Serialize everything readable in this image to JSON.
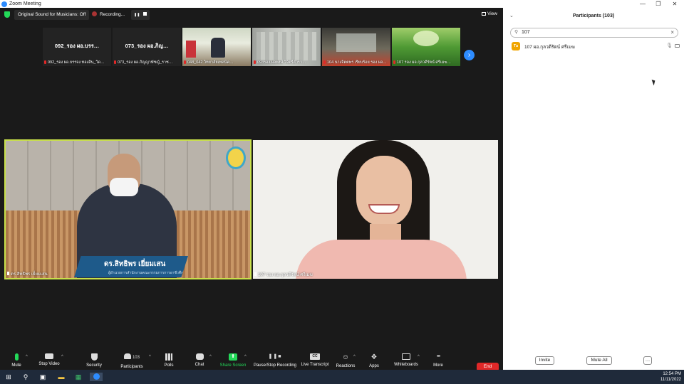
{
  "window": {
    "title": "Zoom Meeting",
    "minimize": "—",
    "restore": "❐",
    "close": "✕"
  },
  "topbar": {
    "sound_label": "Original Sound for Musicians: Off",
    "recording_label": "Recording...",
    "pause_glyph": "❚❚",
    "view_label": "View"
  },
  "thumbnails": [
    {
      "big_name": "092_รอง ผอ.บรร…",
      "caption": "092_รอง ผอ.บรรจง ทองสิน_วิด…"
    },
    {
      "big_name": "073_รอง ผอ.ภิญ…",
      "caption": "073_รอง ผอ.ภิญญาพัชญ์_ราช…"
    },
    {
      "big_name": "",
      "caption": "048_042 วิทยาลัยเทคนิค…"
    },
    {
      "big_name": "",
      "caption": "093รอง.ผอพงษ์ วิจิตรีสำรา…"
    },
    {
      "big_name": "",
      "caption": "104 นางจิตตพร เรียบร้อย รอง ผอ…"
    },
    {
      "big_name": "",
      "caption": "107 รอง ผอ.กุลวดีรัตน์ ศรีเมฆ…"
    }
  ],
  "next_arrow": "›",
  "main_left": {
    "banner_name": "ดร.สิทธิพร เยี่ยมเสน",
    "banner_sub": "ผู้อำนวยการสำนักงานคณะกรรมการการอาชีวศึกษา",
    "caption": "ดร.สิทธิพร เยี่ยมเสน"
  },
  "main_right": {
    "caption": "107 รอง ผอ.กุลวดีรัตน์ ศรีเมฆ"
  },
  "toolbar": {
    "items": [
      {
        "label": "Mute",
        "glyph": "🎙"
      },
      {
        "label": "Stop Video",
        "glyph": "📹"
      },
      {
        "label": "Security",
        "glyph": "🛡"
      },
      {
        "label": "Participants",
        "glyph": "👥",
        "count": "103"
      },
      {
        "label": "Polls",
        "glyph": "📊"
      },
      {
        "label": "Chat",
        "glyph": "💬"
      },
      {
        "label": "Share Screen",
        "glyph": "⬆"
      },
      {
        "label": "Pause/Stop Recording",
        "glyph": "❚❚■"
      },
      {
        "label": "Live Transcript",
        "glyph": "CC"
      },
      {
        "label": "Reactions",
        "glyph": "☺"
      },
      {
        "label": "Apps",
        "glyph": "❖"
      },
      {
        "label": "Whiteboards",
        "glyph": "▭"
      },
      {
        "label": "More",
        "glyph": "•••"
      }
    ],
    "end_label": "End"
  },
  "panel": {
    "title": "Participants (103)",
    "search_value": "107",
    "participant": {
      "initials": "Tu",
      "name": "107 ผอ.กุลวดีรัตน์ ศรีเมฆ"
    },
    "invite_label": "Invite",
    "mute_all_label": "Mute All",
    "more_label": "…"
  },
  "taskbar": {
    "time": "12:54 PM",
    "date": "11/11/2022"
  },
  "colors": {
    "accent": "#2d8cff",
    "end": "#e02828",
    "share": "#23d959",
    "speaker_border": "#c8e04a"
  }
}
